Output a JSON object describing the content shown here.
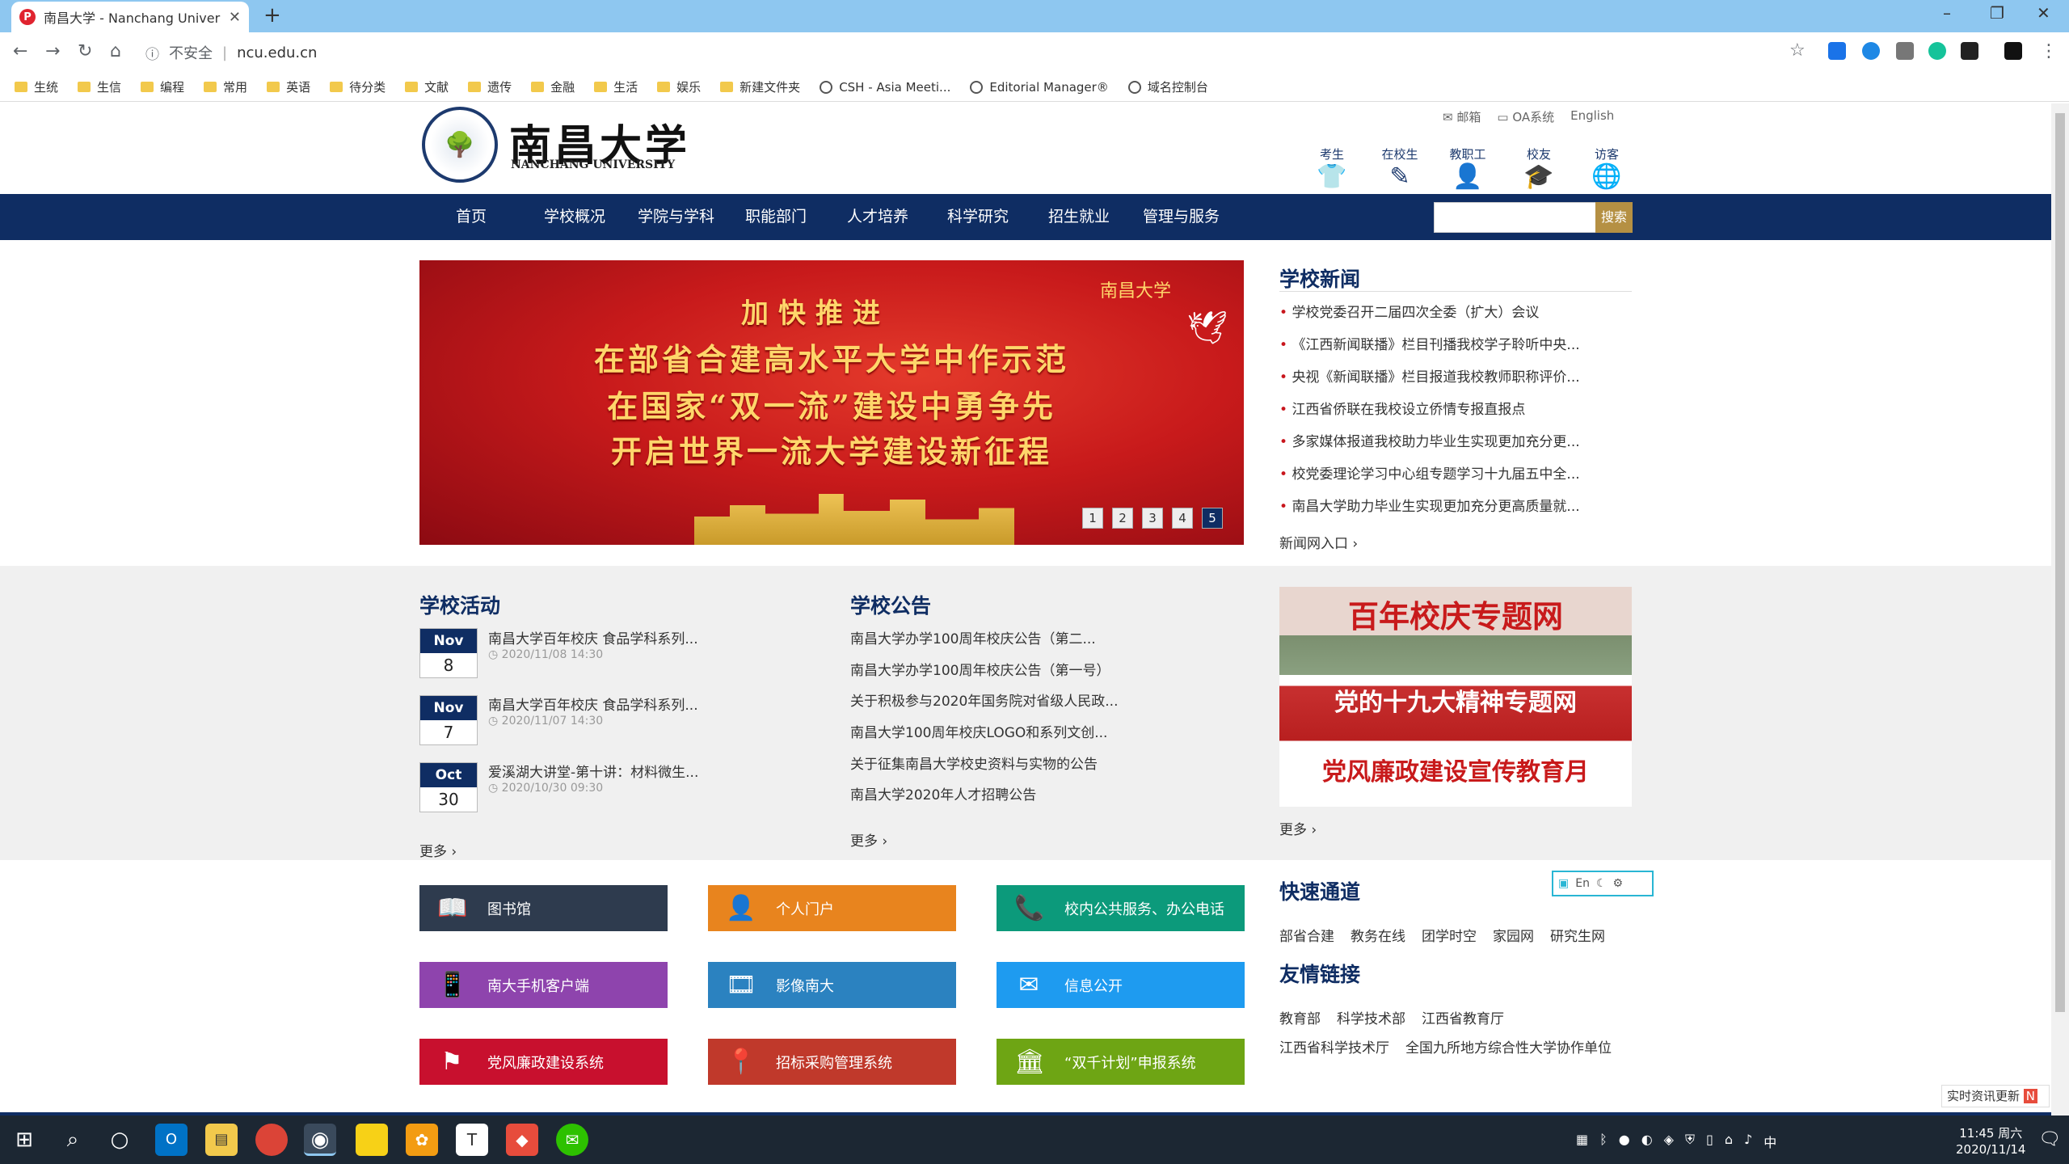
{
  "browser": {
    "tab_title": "南昌大学 - Nanchang Universit",
    "tab_favicon": "P",
    "address_security": "不安全",
    "address_url": "ncu.edu.cn",
    "new_tab": "+",
    "win_min": "–",
    "win_max": "❐",
    "win_close": "✕",
    "bookmarks": [
      {
        "label": "生统",
        "icon": "folder"
      },
      {
        "label": "生信",
        "icon": "folder"
      },
      {
        "label": "编程",
        "icon": "folder"
      },
      {
        "label": "常用",
        "icon": "folder"
      },
      {
        "label": "英语",
        "icon": "folder"
      },
      {
        "label": "待分类",
        "icon": "folder"
      },
      {
        "label": "文献",
        "icon": "folder"
      },
      {
        "label": "遗传",
        "icon": "folder"
      },
      {
        "label": "金融",
        "icon": "folder"
      },
      {
        "label": "生活",
        "icon": "folder"
      },
      {
        "label": "娱乐",
        "icon": "folder"
      },
      {
        "label": "新建文件夹",
        "icon": "folder"
      },
      {
        "label": "CSH - Asia Meeti...",
        "icon": "globe"
      },
      {
        "label": "Editorial Manager®",
        "icon": "em"
      },
      {
        "label": "域名控制台",
        "icon": "globe"
      }
    ]
  },
  "site": {
    "top_links": [
      {
        "label": "邮箱",
        "icon": "mail-icon"
      },
      {
        "label": "OA系统",
        "icon": "folder-icon"
      },
      {
        "label": "English",
        "icon": ""
      }
    ],
    "logo_cn": "南昌大学",
    "logo_en": "NANCHANG UNIVERSITY",
    "quick_entries": [
      {
        "label": "考生",
        "icon": "👕"
      },
      {
        "label": "在校生",
        "icon": "✎"
      },
      {
        "label": "教职工",
        "icon": "👤"
      },
      {
        "label": "校友",
        "icon": "🎓"
      },
      {
        "label": "访客",
        "icon": "🌐"
      }
    ],
    "nav": [
      "首页",
      "学校概况",
      "学院与学科",
      "职能部门",
      "人才培养",
      "科学研究",
      "招生就业",
      "管理与服务"
    ],
    "search_button": "搜索",
    "banner": {
      "line1": "加快推进",
      "line2": "在部省合建高水平大学中作示范",
      "line3": "在国家“双一流”建设中勇争先",
      "line4": "开启世界一流大学建设新征程",
      "seal": "南昌大学",
      "pages": [
        "1",
        "2",
        "3",
        "4",
        "5"
      ],
      "active_page": "5"
    },
    "news": {
      "title": "学校新闻",
      "items": [
        "学校党委召开二届四次全委（扩大）会议",
        "《江西新闻联播》栏目刊播我校学子聆听中央...",
        "央视《新闻联播》栏目报道我校教师职称评价...",
        "江西省侨联在我校设立侨情专报直报点",
        "多家媒体报道我校助力毕业生实现更加充分更...",
        "校党委理论学习中心组专题学习十九届五中全...",
        "南昌大学助力毕业生实现更加充分更高质量就..."
      ],
      "more": "新闻网入口 ›"
    },
    "activities": {
      "title": "学校活动",
      "items": [
        {
          "month": "Nov",
          "day": "8",
          "text": "南昌大学百年校庆 食品学科系列...",
          "time": "2020/11/08 14:30"
        },
        {
          "month": "Nov",
          "day": "7",
          "text": "南昌大学百年校庆 食品学科系列...",
          "time": "2020/11/07 14:30"
        },
        {
          "month": "Oct",
          "day": "30",
          "text": "爱溪湖大讲堂-第十讲：材料微生...",
          "time": "2020/10/30 09:30"
        }
      ],
      "more": "更多 ›"
    },
    "notices": {
      "title": "学校公告",
      "items": [
        "南昌大学办学100周年校庆公告（第二...",
        "南昌大学办学100周年校庆公告（第一号）",
        "关于积极参与2020年国务院对省级人民政...",
        "南昌大学100周年校庆LOGO和系列文创...",
        "关于征集南昌大学校史资料与实物的公告",
        "南昌大学2020年人才招聘公告"
      ],
      "more": "更多 ›"
    },
    "promo": {
      "line1": "百年校庆专题网",
      "line2": "党的十九大精神专题网",
      "line3": "党风廉政建设宣传教育月",
      "more": "更多 ›"
    },
    "tiles": [
      {
        "label": "图书馆",
        "color": "#2e3b4e",
        "icon": "📖"
      },
      {
        "label": "个人门户",
        "color": "#e8841e",
        "icon": "👤"
      },
      {
        "label": "校内公共服务、办公电话",
        "color": "#0c9a7b",
        "icon": "📞"
      },
      {
        "label": "南大手机客户端",
        "color": "#8e44ad",
        "icon": "📱"
      },
      {
        "label": "影像南大",
        "color": "#2b82c0",
        "icon": "🎞"
      },
      {
        "label": "信息公开",
        "color": "#1e9bf0",
        "icon": "✉"
      },
      {
        "label": "党风廉政建设系统",
        "color": "#c8102e",
        "icon": "⚑"
      },
      {
        "label": "招标采购管理系统",
        "color": "#c0392b",
        "icon": "📍"
      },
      {
        "label": "“双千计划”申报系统",
        "color": "#6ea514",
        "icon": "🏛"
      }
    ],
    "quick_channel": {
      "title": "快速通道",
      "links": [
        "部省合建",
        "教务在线",
        "团学时空",
        "家园网",
        "研究生网"
      ]
    },
    "friend_links": {
      "title": "友情链接",
      "row1": [
        "教育部",
        "科学技术部",
        "江西省教育厅"
      ],
      "row2": [
        "江西省科学技术厅",
        "全国九所地方综合性大学协作单位"
      ]
    },
    "translate_box": "En",
    "realtime": "实时资讯更新"
  },
  "taskbar": {
    "time": "11:45 周六",
    "date": "2020/11/14",
    "ime": "中"
  }
}
